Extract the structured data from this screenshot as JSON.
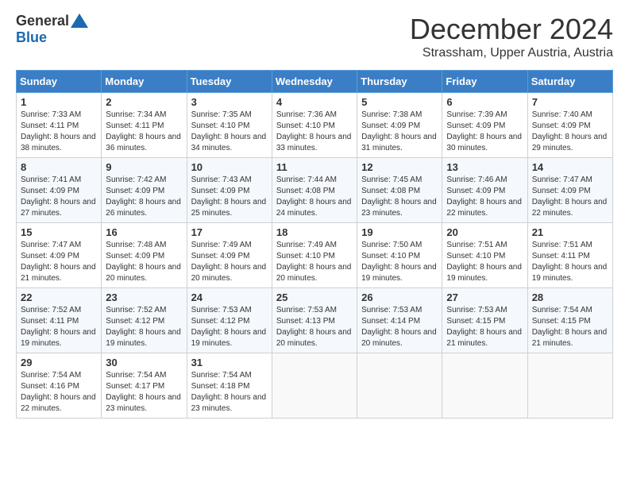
{
  "logo": {
    "general": "General",
    "blue": "Blue"
  },
  "title": "December 2024",
  "location": "Strassham, Upper Austria, Austria",
  "days_header": [
    "Sunday",
    "Monday",
    "Tuesday",
    "Wednesday",
    "Thursday",
    "Friday",
    "Saturday"
  ],
  "weeks": [
    [
      {
        "day": 1,
        "sunrise": "Sunrise: 7:33 AM",
        "sunset": "Sunset: 4:11 PM",
        "daylight": "Daylight: 8 hours and 38 minutes."
      },
      {
        "day": 2,
        "sunrise": "Sunrise: 7:34 AM",
        "sunset": "Sunset: 4:11 PM",
        "daylight": "Daylight: 8 hours and 36 minutes."
      },
      {
        "day": 3,
        "sunrise": "Sunrise: 7:35 AM",
        "sunset": "Sunset: 4:10 PM",
        "daylight": "Daylight: 8 hours and 34 minutes."
      },
      {
        "day": 4,
        "sunrise": "Sunrise: 7:36 AM",
        "sunset": "Sunset: 4:10 PM",
        "daylight": "Daylight: 8 hours and 33 minutes."
      },
      {
        "day": 5,
        "sunrise": "Sunrise: 7:38 AM",
        "sunset": "Sunset: 4:09 PM",
        "daylight": "Daylight: 8 hours and 31 minutes."
      },
      {
        "day": 6,
        "sunrise": "Sunrise: 7:39 AM",
        "sunset": "Sunset: 4:09 PM",
        "daylight": "Daylight: 8 hours and 30 minutes."
      },
      {
        "day": 7,
        "sunrise": "Sunrise: 7:40 AM",
        "sunset": "Sunset: 4:09 PM",
        "daylight": "Daylight: 8 hours and 29 minutes."
      }
    ],
    [
      {
        "day": 8,
        "sunrise": "Sunrise: 7:41 AM",
        "sunset": "Sunset: 4:09 PM",
        "daylight": "Daylight: 8 hours and 27 minutes."
      },
      {
        "day": 9,
        "sunrise": "Sunrise: 7:42 AM",
        "sunset": "Sunset: 4:09 PM",
        "daylight": "Daylight: 8 hours and 26 minutes."
      },
      {
        "day": 10,
        "sunrise": "Sunrise: 7:43 AM",
        "sunset": "Sunset: 4:09 PM",
        "daylight": "Daylight: 8 hours and 25 minutes."
      },
      {
        "day": 11,
        "sunrise": "Sunrise: 7:44 AM",
        "sunset": "Sunset: 4:08 PM",
        "daylight": "Daylight: 8 hours and 24 minutes."
      },
      {
        "day": 12,
        "sunrise": "Sunrise: 7:45 AM",
        "sunset": "Sunset: 4:08 PM",
        "daylight": "Daylight: 8 hours and 23 minutes."
      },
      {
        "day": 13,
        "sunrise": "Sunrise: 7:46 AM",
        "sunset": "Sunset: 4:09 PM",
        "daylight": "Daylight: 8 hours and 22 minutes."
      },
      {
        "day": 14,
        "sunrise": "Sunrise: 7:47 AM",
        "sunset": "Sunset: 4:09 PM",
        "daylight": "Daylight: 8 hours and 22 minutes."
      }
    ],
    [
      {
        "day": 15,
        "sunrise": "Sunrise: 7:47 AM",
        "sunset": "Sunset: 4:09 PM",
        "daylight": "Daylight: 8 hours and 21 minutes."
      },
      {
        "day": 16,
        "sunrise": "Sunrise: 7:48 AM",
        "sunset": "Sunset: 4:09 PM",
        "daylight": "Daylight: 8 hours and 20 minutes."
      },
      {
        "day": 17,
        "sunrise": "Sunrise: 7:49 AM",
        "sunset": "Sunset: 4:09 PM",
        "daylight": "Daylight: 8 hours and 20 minutes."
      },
      {
        "day": 18,
        "sunrise": "Sunrise: 7:49 AM",
        "sunset": "Sunset: 4:10 PM",
        "daylight": "Daylight: 8 hours and 20 minutes."
      },
      {
        "day": 19,
        "sunrise": "Sunrise: 7:50 AM",
        "sunset": "Sunset: 4:10 PM",
        "daylight": "Daylight: 8 hours and 19 minutes."
      },
      {
        "day": 20,
        "sunrise": "Sunrise: 7:51 AM",
        "sunset": "Sunset: 4:10 PM",
        "daylight": "Daylight: 8 hours and 19 minutes."
      },
      {
        "day": 21,
        "sunrise": "Sunrise: 7:51 AM",
        "sunset": "Sunset: 4:11 PM",
        "daylight": "Daylight: 8 hours and 19 minutes."
      }
    ],
    [
      {
        "day": 22,
        "sunrise": "Sunrise: 7:52 AM",
        "sunset": "Sunset: 4:11 PM",
        "daylight": "Daylight: 8 hours and 19 minutes."
      },
      {
        "day": 23,
        "sunrise": "Sunrise: 7:52 AM",
        "sunset": "Sunset: 4:12 PM",
        "daylight": "Daylight: 8 hours and 19 minutes."
      },
      {
        "day": 24,
        "sunrise": "Sunrise: 7:53 AM",
        "sunset": "Sunset: 4:12 PM",
        "daylight": "Daylight: 8 hours and 19 minutes."
      },
      {
        "day": 25,
        "sunrise": "Sunrise: 7:53 AM",
        "sunset": "Sunset: 4:13 PM",
        "daylight": "Daylight: 8 hours and 20 minutes."
      },
      {
        "day": 26,
        "sunrise": "Sunrise: 7:53 AM",
        "sunset": "Sunset: 4:14 PM",
        "daylight": "Daylight: 8 hours and 20 minutes."
      },
      {
        "day": 27,
        "sunrise": "Sunrise: 7:53 AM",
        "sunset": "Sunset: 4:15 PM",
        "daylight": "Daylight: 8 hours and 21 minutes."
      },
      {
        "day": 28,
        "sunrise": "Sunrise: 7:54 AM",
        "sunset": "Sunset: 4:15 PM",
        "daylight": "Daylight: 8 hours and 21 minutes."
      }
    ],
    [
      {
        "day": 29,
        "sunrise": "Sunrise: 7:54 AM",
        "sunset": "Sunset: 4:16 PM",
        "daylight": "Daylight: 8 hours and 22 minutes."
      },
      {
        "day": 30,
        "sunrise": "Sunrise: 7:54 AM",
        "sunset": "Sunset: 4:17 PM",
        "daylight": "Daylight: 8 hours and 23 minutes."
      },
      {
        "day": 31,
        "sunrise": "Sunrise: 7:54 AM",
        "sunset": "Sunset: 4:18 PM",
        "daylight": "Daylight: 8 hours and 23 minutes."
      },
      null,
      null,
      null,
      null
    ]
  ]
}
